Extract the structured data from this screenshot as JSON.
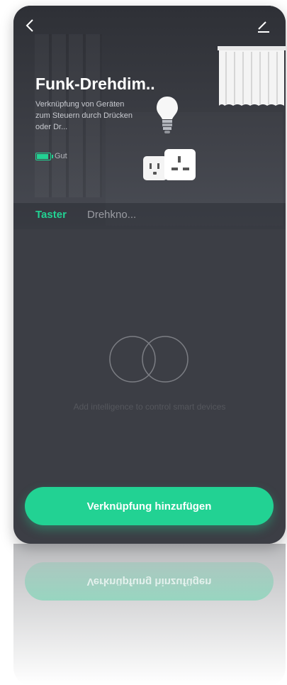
{
  "header": {
    "title": "Funk-Drehdim..",
    "subtitle": "Verknüpfung von Geräten zum Steuern durch Drücken oder Dr...",
    "battery_label": "Gut",
    "battery_level": 1.0
  },
  "tabs": [
    {
      "label": "Taster",
      "active": true
    },
    {
      "label": "Drehkno...",
      "active": false
    }
  ],
  "empty_state": {
    "text": "Add intelligence to control smart devices"
  },
  "actions": {
    "add_label": "Verknüpfung hinzufügen"
  },
  "colors": {
    "accent": "#22d293",
    "background": "#3c3e45",
    "header": "#2e3036"
  },
  "icons": {
    "back": "chevron-left-icon",
    "edit": "edit-icon",
    "battery": "battery-icon",
    "curtain": "curtain-icon",
    "bulb": "light-bulb-icon",
    "outlet": "power-outlet-icon",
    "empty": "linked-circles-icon"
  }
}
